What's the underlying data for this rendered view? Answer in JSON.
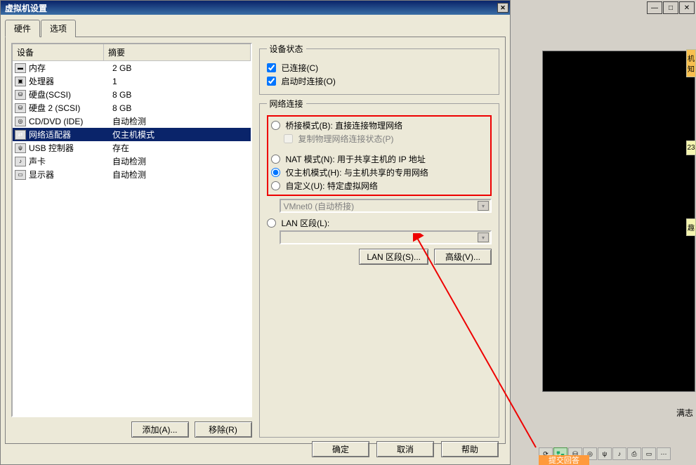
{
  "dialog": {
    "title": "虚拟机设置",
    "tabs": {
      "hardware": "硬件",
      "options": "选项"
    },
    "device_header": {
      "name": "设备",
      "summary": "摘要"
    },
    "devices": [
      {
        "label": "内存",
        "summary": "2 GB"
      },
      {
        "label": "处理器",
        "summary": "1"
      },
      {
        "label": "硬盘(SCSI)",
        "summary": "8 GB"
      },
      {
        "label": "硬盘 2 (SCSI)",
        "summary": "8 GB"
      },
      {
        "label": "CD/DVD (IDE)",
        "summary": "自动检测"
      },
      {
        "label": "网络适配器",
        "summary": "仅主机模式"
      },
      {
        "label": "USB 控制器",
        "summary": "存在"
      },
      {
        "label": "声卡",
        "summary": "自动检测"
      },
      {
        "label": "显示器",
        "summary": "自动检测"
      }
    ],
    "selected_device_index": 5,
    "left_buttons": {
      "add": "添加(A)...",
      "remove": "移除(R)"
    }
  },
  "status_group": {
    "legend": "设备状态",
    "connected": "已连接(C)",
    "connect_on_power": "启动时连接(O)"
  },
  "network_group": {
    "legend": "网络连接",
    "bridged": "桥接模式(B): 直接连接物理网络",
    "replicate": "复制物理网络连接状态(P)",
    "nat": "NAT 模式(N): 用于共享主机的 IP 地址",
    "hostonly": "仅主机模式(H): 与主机共享的专用网络",
    "custom": "自定义(U): 特定虚拟网络",
    "custom_value": "VMnet0 (自动桥接)",
    "lan": "LAN 区段(L):",
    "lan_value": "",
    "lan_btn": "LAN 区段(S)...",
    "adv_btn": "高级(V)..."
  },
  "bottom": {
    "ok": "确定",
    "cancel": "取消",
    "help": "帮助"
  },
  "side": {
    "tag1": "机知",
    "tag2": "23",
    "tag3": "趣",
    "label": "满志",
    "hint": "提交回答"
  }
}
